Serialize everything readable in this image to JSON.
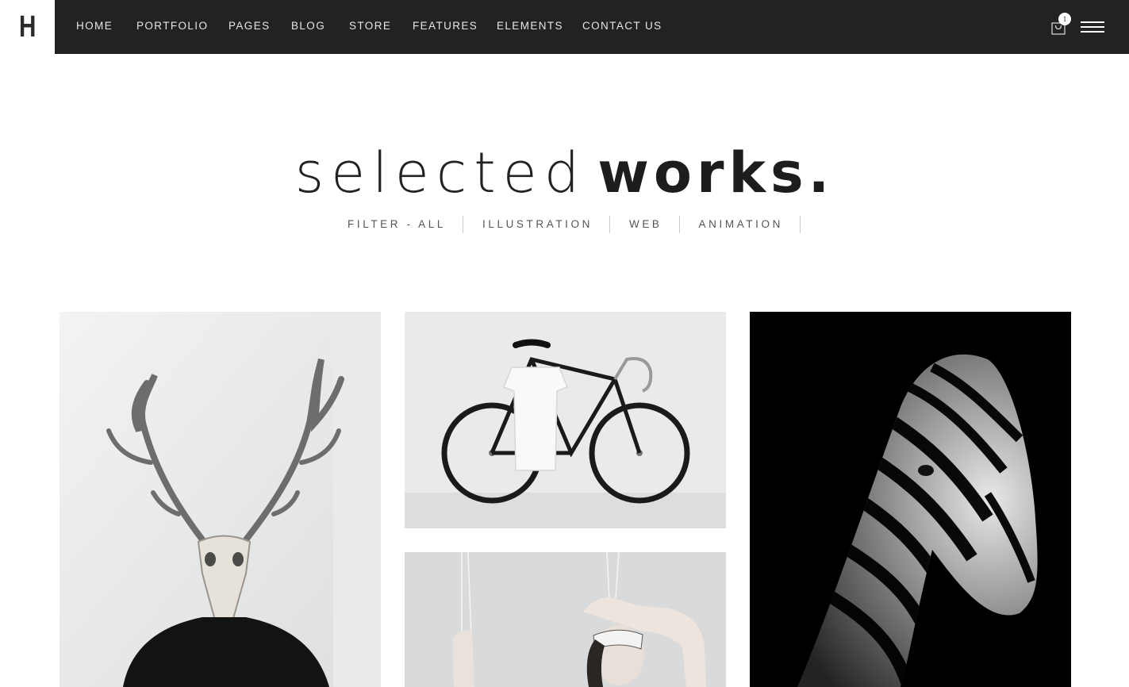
{
  "brand": {
    "logo_letter": "H"
  },
  "nav": {
    "items": [
      {
        "label": "HOME"
      },
      {
        "label": "PORTFOLIO"
      },
      {
        "label": "PAGES"
      },
      {
        "label": "BLOG"
      },
      {
        "label": "STORE"
      },
      {
        "label": "FEATURES"
      },
      {
        "label": "ELEMENTS"
      },
      {
        "label": "CONTACT US"
      }
    ],
    "cart_count": "1",
    "cart_icon": "shopping-bag-icon",
    "menu_icon": "hamburger-menu-icon"
  },
  "heading": {
    "light": "selected",
    "bold": "works."
  },
  "filters": [
    {
      "label": "FILTER - ALL"
    },
    {
      "label": "ILLUSTRATION"
    },
    {
      "label": "WEB"
    },
    {
      "label": "ANIMATION"
    }
  ],
  "colors": {
    "nav_bg": "#222222",
    "text_dark": "#1d1d1d",
    "filter_text": "#555555"
  }
}
